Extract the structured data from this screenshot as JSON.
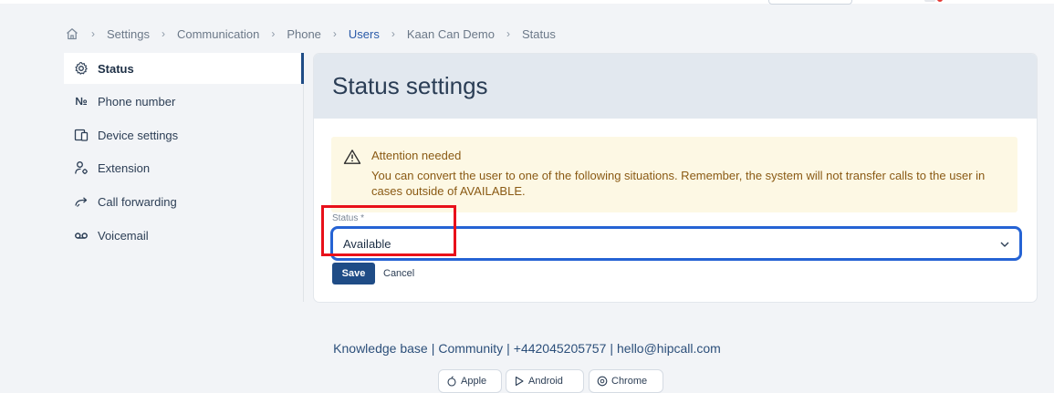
{
  "breadcrumb": {
    "items": [
      "Settings",
      "Communication",
      "Phone",
      "Users",
      "Kaan Can Demo",
      "Status"
    ]
  },
  "sidebar": {
    "items": [
      {
        "label": "Status",
        "icon": "gear-icon",
        "active": true
      },
      {
        "label": "Phone number",
        "icon": "numero-sign-icon",
        "active": false
      },
      {
        "label": "Device settings",
        "icon": "devices-icon",
        "active": false
      },
      {
        "label": "Extension",
        "icon": "user-gear-icon",
        "active": false
      },
      {
        "label": "Call forwarding",
        "icon": "forward-arrow-icon",
        "active": false
      },
      {
        "label": "Voicemail",
        "icon": "voicemail-icon",
        "active": false
      }
    ]
  },
  "main": {
    "title": "Status settings",
    "alert": {
      "title": "Attention needed",
      "text": "You can convert the user to one of the following situations. Remember, the system will not transfer calls to the user in cases outside of AVAILABLE."
    },
    "status_field": {
      "label": "Status *",
      "value": "Available"
    },
    "save_label": "Save",
    "cancel_label": "Cancel"
  },
  "footer": {
    "links": [
      "Knowledge base",
      "Community",
      "+442045205757",
      "hello@hipcall.com"
    ],
    "separator": "|",
    "stores": [
      "Apple",
      "Android",
      "Chrome"
    ]
  },
  "colors": {
    "primary": "#1f4c86",
    "focus_border": "#2563d4",
    "highlight": "#e8101a",
    "alert_bg": "#fdf8e4",
    "alert_text": "#8a5a14",
    "link": "#2a5aa8"
  }
}
